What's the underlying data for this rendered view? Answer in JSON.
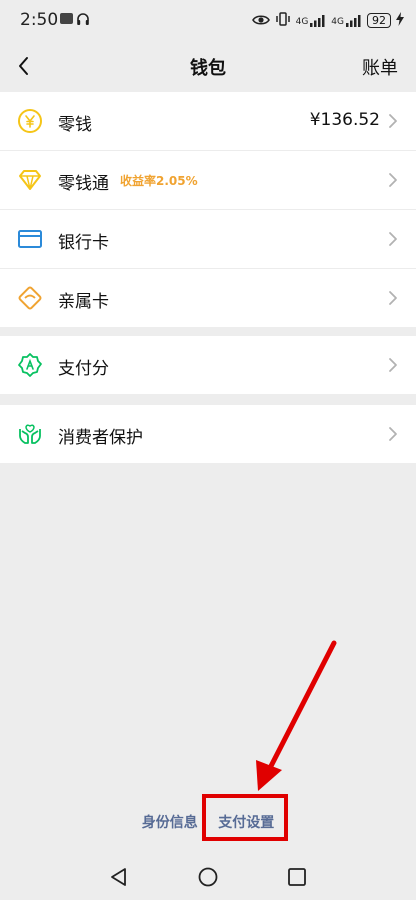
{
  "status_bar": {
    "time": "2:50",
    "left_icons": [
      "notification-badge-icon",
      "headphones-icon"
    ],
    "right_icons": [
      "eye-icon",
      "vibrate-icon",
      "4g-signal-icon",
      "4g-signal-icon"
    ],
    "network_1": "4G",
    "network_2": "4G",
    "battery": "92"
  },
  "nav": {
    "title": "钱包",
    "right_label": "账单"
  },
  "wallet_items": [
    {
      "label": "零钱",
      "value": "¥136.52",
      "icon": "coin-icon",
      "color": "#f5c518"
    },
    {
      "label": "零钱通",
      "tag": "收益率2.05%",
      "icon": "diamond-icon",
      "color": "#f5c518"
    },
    {
      "label": "银行卡",
      "icon": "bank-card-icon",
      "color": "#2b8ad9"
    },
    {
      "label": "亲属卡",
      "icon": "family-card-icon",
      "color": "#f0a331"
    }
  ],
  "score_items": [
    {
      "label": "支付分",
      "icon": "payment-score-icon",
      "color": "#07c160"
    }
  ],
  "protect_items": [
    {
      "label": "消费者保护",
      "icon": "consumer-protection-icon",
      "color": "#07c160"
    }
  ],
  "footer": {
    "identity_link": "身份信息",
    "settings_link": "支付设置"
  },
  "annotation": {
    "color": "#e00000"
  },
  "system_nav": {
    "back": "back-triangle-icon",
    "home": "home-circle-icon",
    "recents": "recents-square-icon"
  }
}
